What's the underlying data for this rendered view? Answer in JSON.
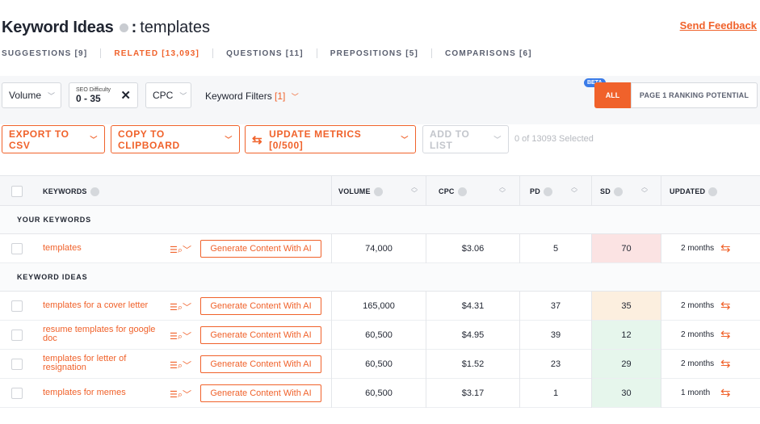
{
  "header": {
    "title": "Keyword Ideas",
    "separator": ":",
    "term": "templates",
    "feedback_label": "Send Feedback"
  },
  "tabs": [
    {
      "label": "SUGGESTIONS [9]"
    },
    {
      "label": "RELATED [13,093]",
      "active": true
    },
    {
      "label": "QUESTIONS [11]"
    },
    {
      "label": "PREPOSITIONS [5]"
    },
    {
      "label": "COMPARISONS [6]"
    }
  ],
  "filters": {
    "volume_label": "Volume",
    "sd_label": "SEO Difficulty",
    "sd_value": "0 - 35",
    "sd_clear": "✕",
    "cpc_label": "CPC",
    "keyword_filters_label": "Keyword Filters",
    "keyword_filters_count": "[1]",
    "beta_badge": "BETA",
    "segment_all": "ALL",
    "segment_page1": "PAGE 1 RANKING POTENTIAL"
  },
  "actions": {
    "export_label": "EXPORT TO CSV",
    "copy_label": "COPY TO CLIPBOARD",
    "update_label": "UPDATE METRICS [0/500]",
    "add_label": "ADD TO LIST",
    "selected_text": "0 of 13093 Selected"
  },
  "table": {
    "columns": {
      "keywords": "KEYWORDS",
      "volume": "VOLUME",
      "cpc": "CPC",
      "pd": "PD",
      "sd": "SD",
      "updated": "UPDATED"
    },
    "section_your": "YOUR KEYWORDS",
    "section_ideas": "KEYWORD IDEAS",
    "generate_label": "Generate Content With AI",
    "your_rows": [
      {
        "keyword": "templates",
        "volume": "74,000",
        "cpc": "$3.06",
        "pd": "5",
        "sd": "70",
        "updated": "2 months",
        "sd_color": "#fbe3e3"
      }
    ],
    "idea_rows": [
      {
        "keyword": "templates for a cover letter",
        "volume": "165,000",
        "cpc": "$4.31",
        "pd": "37",
        "sd": "35",
        "updated": "2 months",
        "sd_color": "#fcefdf"
      },
      {
        "keyword": "resume templates for google doc",
        "volume": "60,500",
        "cpc": "$4.95",
        "pd": "39",
        "sd": "12",
        "updated": "2 months",
        "sd_color": "#e6f6ec"
      },
      {
        "keyword": "templates for letter of resignation",
        "volume": "60,500",
        "cpc": "$1.52",
        "pd": "23",
        "sd": "29",
        "updated": "2 months",
        "sd_color": "#e6f6ec"
      },
      {
        "keyword": "templates for memes",
        "volume": "60,500",
        "cpc": "$3.17",
        "pd": "1",
        "sd": "30",
        "updated": "1 month",
        "sd_color": "#e6f6ec"
      }
    ]
  },
  "colors": {
    "accent": "#f0622b",
    "beta": "#3a7be8"
  }
}
